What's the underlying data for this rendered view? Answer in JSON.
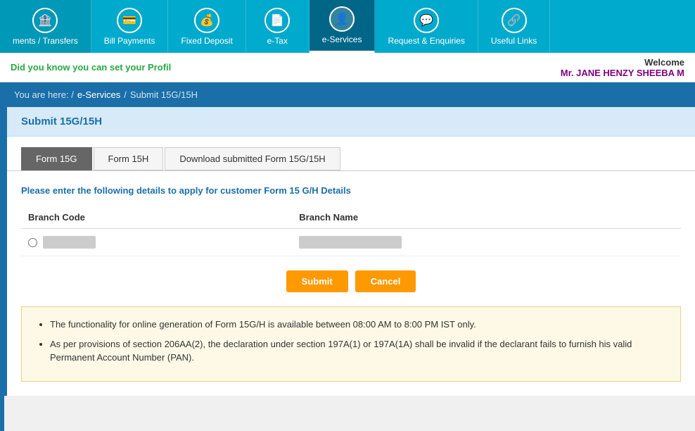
{
  "nav": {
    "items": [
      {
        "id": "payments",
        "label": "ments / Transfers",
        "icon": "🏦",
        "active": false
      },
      {
        "id": "bill-payments",
        "label": "Bill Payments",
        "icon": "💳",
        "active": false
      },
      {
        "id": "fixed-deposit",
        "label": "Fixed Deposit",
        "icon": "💰",
        "active": false
      },
      {
        "id": "e-tax",
        "label": "e-Tax",
        "icon": "📄",
        "active": false
      },
      {
        "id": "e-services",
        "label": "e-Services",
        "icon": "👤",
        "active": true
      },
      {
        "id": "request-enquiries",
        "label": "Request & Enquiries",
        "icon": "💬",
        "active": false
      },
      {
        "id": "useful-links",
        "label": "Useful Links",
        "icon": "❌",
        "active": false
      }
    ]
  },
  "infobar": {
    "marquee": "Did you know you can set your Profil",
    "welcome_label": "Welcome",
    "user_name": "Mr. JANE HENZY SHEEBA M"
  },
  "breadcrumb": {
    "prefix": "You are here: /",
    "link1": "e-Services",
    "separator": "/",
    "current": "Submit 15G/15H"
  },
  "page": {
    "title": "Submit 15G/15H",
    "tabs": [
      {
        "id": "form15g",
        "label": "Form 15G",
        "active": true
      },
      {
        "id": "form15h",
        "label": "Form 15H",
        "active": false
      },
      {
        "id": "download",
        "label": "Download submitted Form 15G/15H",
        "active": false
      }
    ],
    "instruction": "Please enter the following details to apply for customer Form 15 G/H Details",
    "table": {
      "headers": [
        "Branch Code",
        "Branch Name"
      ],
      "row": {
        "code_blurred": "███ ████",
        "name_blurred": "████ ███████ ████"
      }
    },
    "buttons": {
      "submit": "Submit",
      "cancel": "Cancel"
    },
    "notices": [
      "The functionality for online generation of Form 15G/H is available between 08:00 AM to 8:00 PM IST only.",
      "As per provisions of section 206AA(2), the declaration under section 197A(1) or 197A(1A) shall be invalid if the declarant fails to furnish his valid Permanent Account Number (PAN)."
    ]
  }
}
